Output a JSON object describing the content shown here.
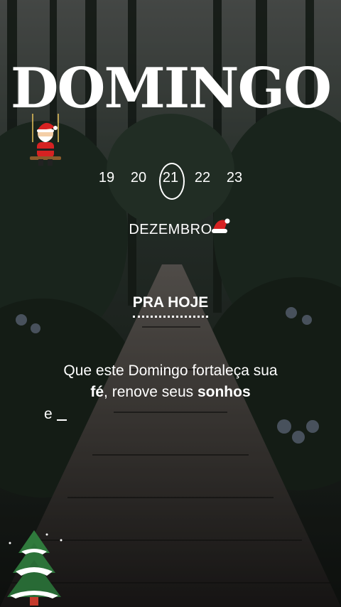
{
  "title": "DOMINGO",
  "dates": [
    "19",
    "20",
    "21",
    "22",
    "23"
  ],
  "active_date": "21",
  "month": "DEZEMBRO",
  "section_label": "PRA HOJE",
  "quote": {
    "line1": "Que este Domingo fortaleça sua",
    "line2_bold1": "fé",
    "line2_mid": ", renove seus ",
    "line2_bold2": "sonhos",
    "line3": "e"
  },
  "decorations": [
    "santa-claus-swing",
    "santa-hat",
    "snowy-pine-tree"
  ],
  "colors": {
    "text": "#ffffff",
    "forest_dark": "#1c211d",
    "walkway": "#3a3733"
  }
}
